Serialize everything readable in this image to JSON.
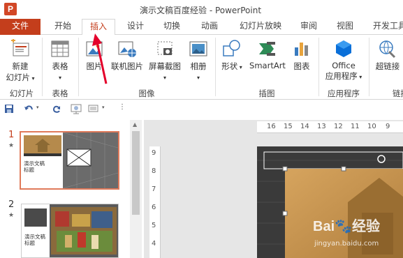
{
  "window": {
    "title": "演示文稿百度经验 - PowerPoint",
    "app_icon_letter": "P"
  },
  "tabs": [
    {
      "label": "文件"
    },
    {
      "label": "开始"
    },
    {
      "label": "插入"
    },
    {
      "label": "设计"
    },
    {
      "label": "切换"
    },
    {
      "label": "动画"
    },
    {
      "label": "幻灯片放映"
    },
    {
      "label": "审阅"
    },
    {
      "label": "视图"
    },
    {
      "label": "开发工具"
    }
  ],
  "active_tab": "插入",
  "ribbon": {
    "new_slide": {
      "label1": "新建",
      "label2": "幻灯片"
    },
    "table": {
      "label": "表格"
    },
    "picture": {
      "label": "图片"
    },
    "online_picture": {
      "label": "联机图片"
    },
    "screenshot": {
      "label": "屏幕截图"
    },
    "album": {
      "label": "相册"
    },
    "shapes": {
      "label": "形状"
    },
    "smartart": {
      "label": "SmartArt"
    },
    "chart": {
      "label": "图表"
    },
    "office_apps": {
      "label1": "Office",
      "label2": "应用程序"
    },
    "hyperlink": {
      "label": "超链接"
    },
    "groups": {
      "slides": "幻灯片",
      "tables": "表格",
      "images": "图像",
      "illustrations": "插图",
      "apps": "应用程序",
      "links": "链接"
    }
  },
  "slides": [
    {
      "number": "1",
      "star": "★",
      "title_line1": "演示文稿",
      "title_line2": "标题"
    },
    {
      "number": "2",
      "star": "★",
      "title_line1": "演示文稿",
      "title_line2": "标题"
    }
  ],
  "rulers": {
    "horizontal": [
      "16",
      "15",
      "14",
      "13",
      "12",
      "11",
      "10",
      "9"
    ],
    "vertical": [
      "9",
      "8",
      "7",
      "6",
      "5",
      "4"
    ]
  },
  "watermark": {
    "brand": "Bai",
    "brand_suffix": "经验",
    "url": "jingyan.baidu.com"
  },
  "colors": {
    "file_tab": "#c43e1c",
    "accent": "#c43e1c",
    "selection": "#e07a5a"
  }
}
